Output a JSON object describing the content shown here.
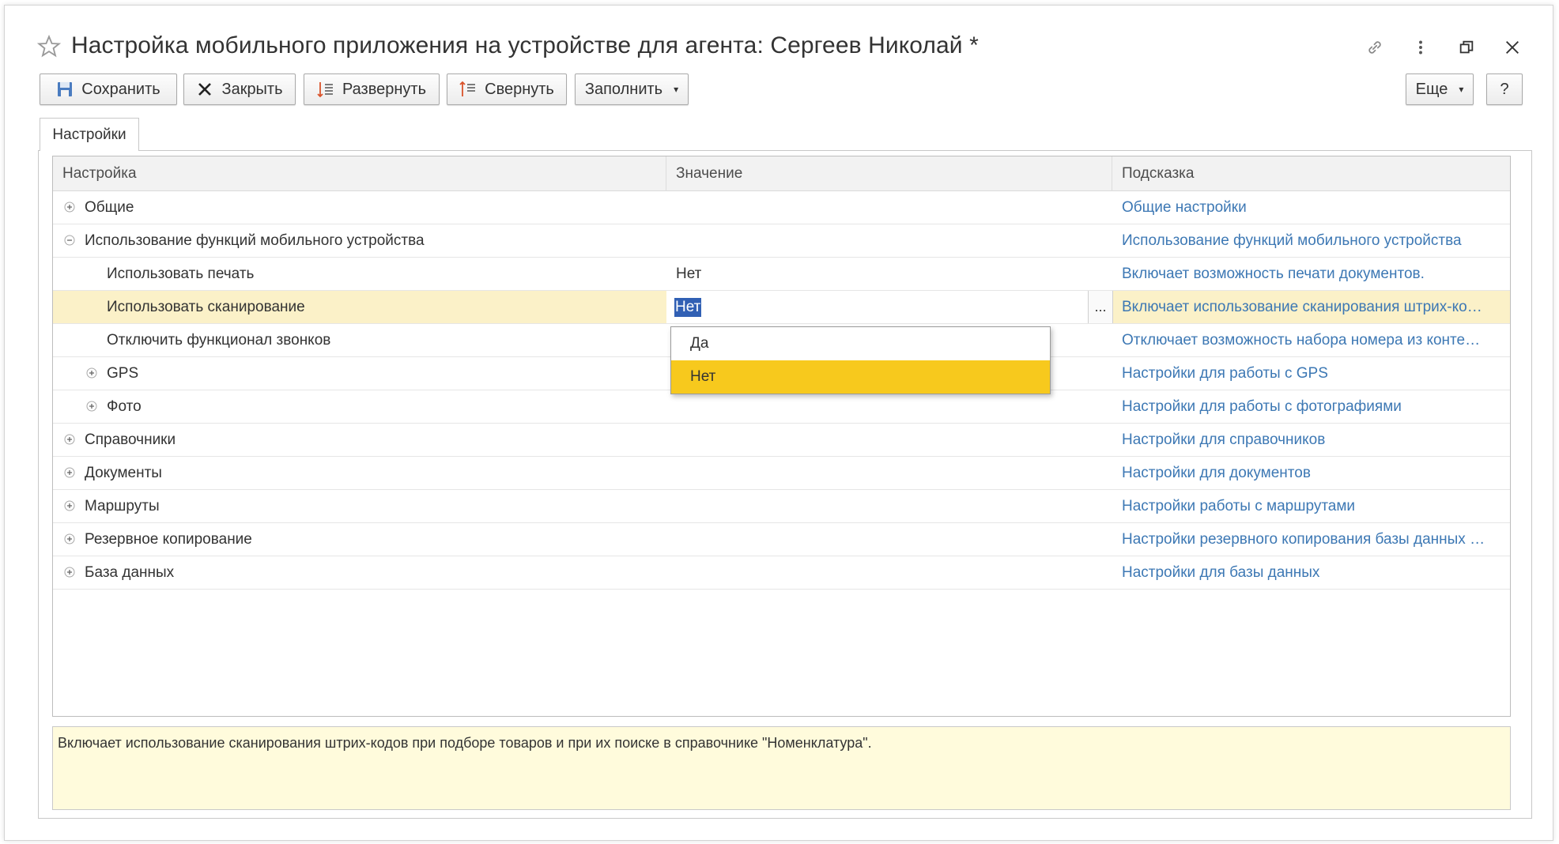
{
  "window": {
    "title": "Настройка мобильного приложения на устройстве для агента: Сергеев Николай *"
  },
  "toolbar": {
    "save_label": "Сохранить",
    "close_label": "Закрыть",
    "expand_label": "Развернуть",
    "collapse_label": "Свернуть",
    "fill_label": "Заполнить",
    "more_label": "Еще",
    "help_label": "?"
  },
  "tabs": [
    {
      "label": "Настройки"
    }
  ],
  "grid": {
    "columns": [
      "Настройка",
      "Значение",
      "Подсказка"
    ],
    "rows": [
      {
        "name": "Общие",
        "value": "",
        "hint": "Общие настройки",
        "level": 0,
        "toggle": "plus"
      },
      {
        "name": "Использование функций мобильного устройства",
        "value": "",
        "hint": "Использование функций мобильного устройства",
        "level": 0,
        "toggle": "minus"
      },
      {
        "name": "Использовать печать",
        "value": "Нет",
        "hint": "Включает возможность печати документов.",
        "level": 1,
        "toggle": "none"
      },
      {
        "name": "Использовать сканирование",
        "value": "Нет",
        "hint": "Включает использование сканирования штрих-ко…",
        "level": 1,
        "toggle": "none",
        "selected": true
      },
      {
        "name": "Отключить функционал звонков",
        "value": "",
        "hint": "Отключает возможность набора номера из конте…",
        "level": 1,
        "toggle": "none"
      },
      {
        "name": "GPS",
        "value": "",
        "hint": "Настройки для работы с GPS",
        "level": 1,
        "toggle": "plus"
      },
      {
        "name": "Фото",
        "value": "",
        "hint": "Настройки для работы с фотографиями",
        "level": 1,
        "toggle": "plus"
      },
      {
        "name": "Справочники",
        "value": "",
        "hint": "Настройки для справочников",
        "level": 0,
        "toggle": "plus"
      },
      {
        "name": "Документы",
        "value": "",
        "hint": "Настройки для документов",
        "level": 0,
        "toggle": "plus"
      },
      {
        "name": "Маршруты",
        "value": "",
        "hint": "Настройки работы с маршрутами",
        "level": 0,
        "toggle": "plus"
      },
      {
        "name": "Резервное копирование",
        "value": "",
        "hint": "Настройки резервного копирования базы данных …",
        "level": 0,
        "toggle": "plus"
      },
      {
        "name": "База данных",
        "value": "",
        "hint": "Настройки для базы данных",
        "level": 0,
        "toggle": "plus"
      }
    ]
  },
  "editor": {
    "value": "Нет",
    "dots_label": "...",
    "options": [
      {
        "label": "Да",
        "active": false
      },
      {
        "label": "Нет",
        "active": true
      }
    ]
  },
  "hint_text": "Включает использование сканирования штрих-кодов при подборе товаров и при их поиске в справочнике \"Номенклатура\".",
  "colors": {
    "hint_link": "#3d78b4",
    "selected_row": "#fbf1c8",
    "dropdown_active": "#f7c91d",
    "text_selection": "#3160b4",
    "hint_box": "#fffbdc"
  }
}
